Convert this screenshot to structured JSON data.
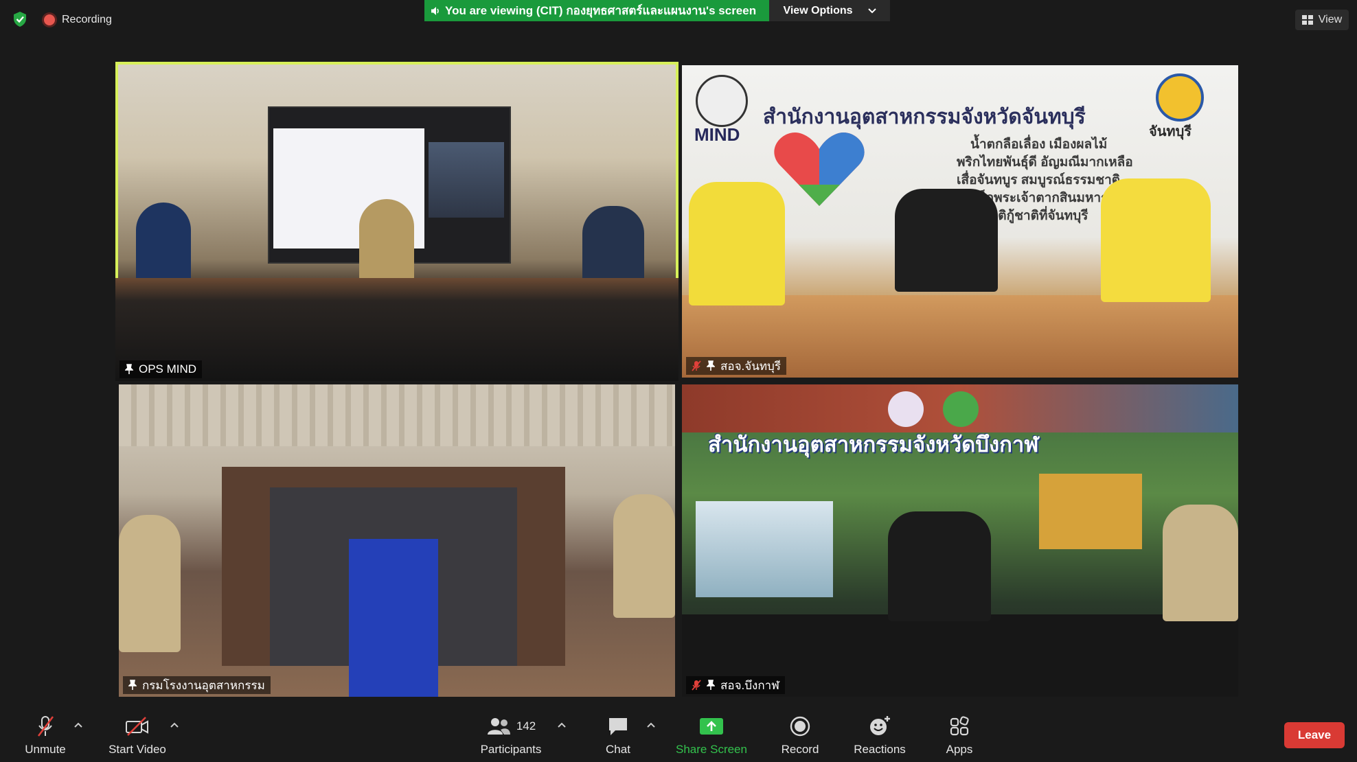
{
  "top_bar": {
    "recording_label": "Recording",
    "share_banner_text": "You are viewing (CIT) กองยุทธศาสตร์และแผนงาน's screen",
    "view_options_label": "View Options",
    "view_label": "View"
  },
  "tiles": [
    {
      "name": "OPS MIND",
      "active_speaker": true,
      "muted": false
    },
    {
      "name": "สอจ.จันทบุรี",
      "muted": true
    },
    {
      "name": "กรมโรงงานอุตสาหกรรม",
      "muted": false
    },
    {
      "name": "สอจ.บึงกาฬ",
      "muted": true
    }
  ],
  "tile2_content": {
    "logo_text": "MIND",
    "heading": "สำนักงานอุตสาหกรรมจังหวัดจันทบุรี",
    "lines": [
      "น้ำตกลือเลื่อง เมืองผลไม้",
      "พริกไทยพันธุ์ดี อัญมณีมากเหลือ",
      "เสื่อจันทบูร สมบูรณ์ธรรมชาติ",
      "สมเด็จพระเจ้าตากสินมหาราช",
      "รวมญาติกู้ชาติที่จันทบุรี"
    ],
    "province_logo_text": "จันทบุรี"
  },
  "tile4_content": {
    "heading": "สำนักงานอุตสาหกรรมจังหวัดบึงกาฬ"
  },
  "toolbar": {
    "unmute_label": "Unmute",
    "start_video_label": "Start Video",
    "participants_label": "Participants",
    "participants_count": "142",
    "chat_label": "Chat",
    "share_screen_label": "Share Screen",
    "record_label": "Record",
    "reactions_label": "Reactions",
    "apps_label": "Apps",
    "leave_label": "Leave"
  },
  "colors": {
    "share_banner": "#1a9a3c",
    "active_speaker_outline": "#d7f05a",
    "leave_button": "#d93a34",
    "share_screen_icon": "#33c24d",
    "muted_red": "#e0403a"
  }
}
